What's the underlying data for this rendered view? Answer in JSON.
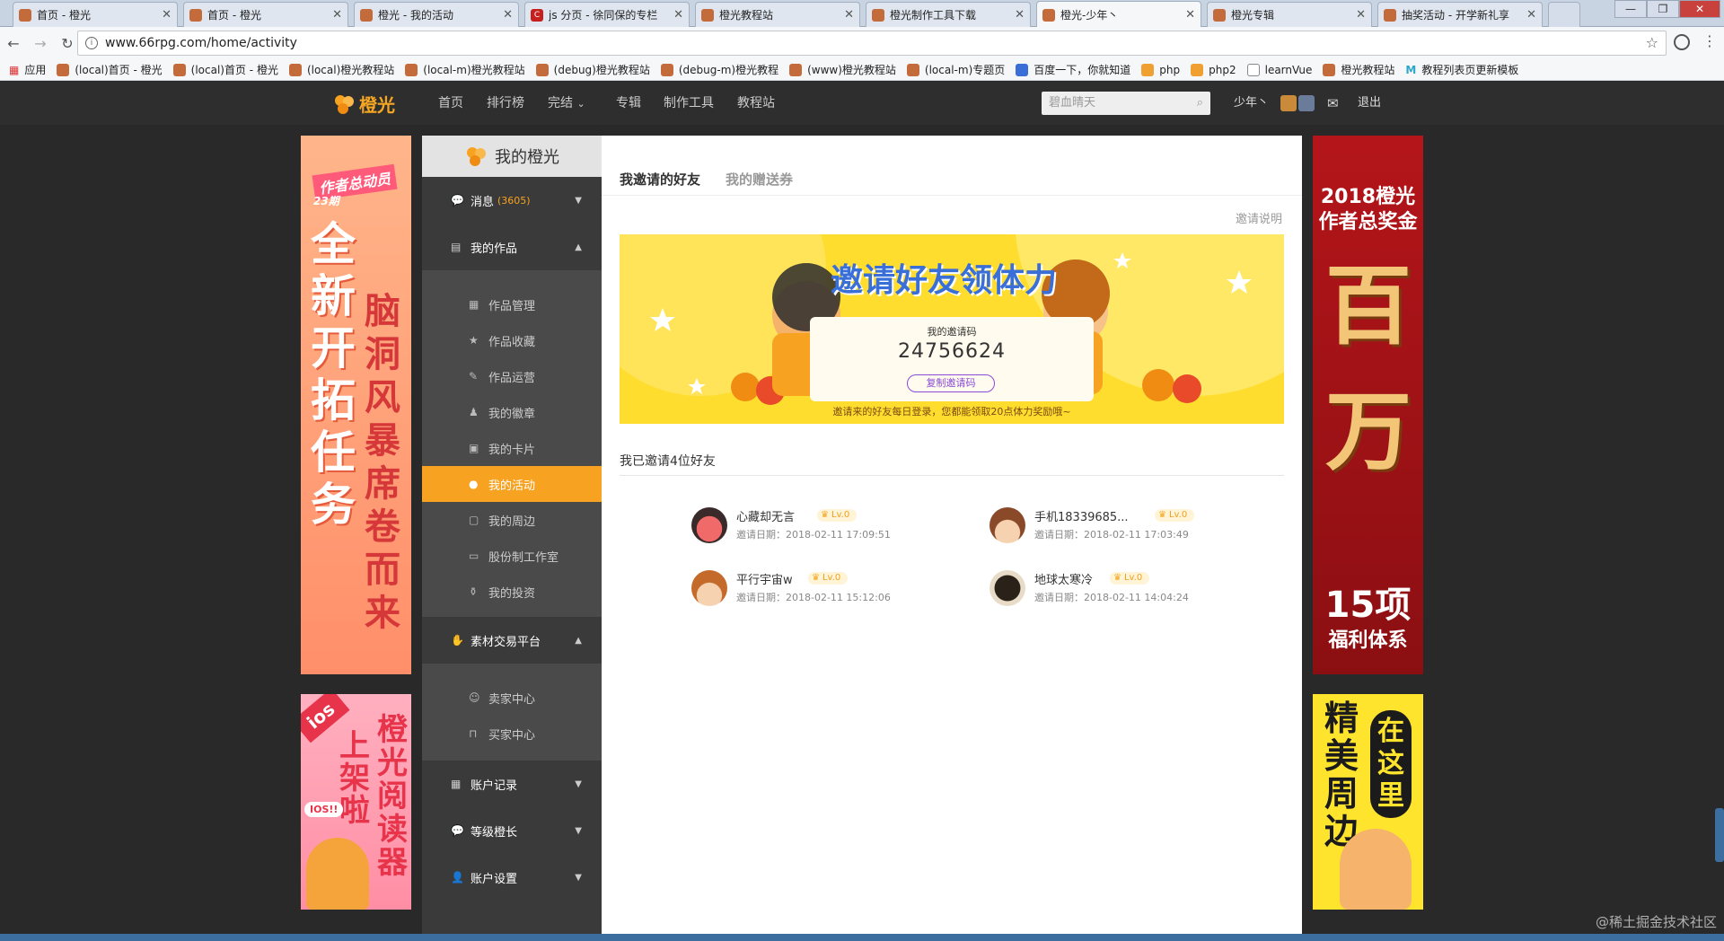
{
  "browser": {
    "tabs": [
      {
        "label": "首页 - 橙光",
        "active": false
      },
      {
        "label": "首页 - 橙光",
        "active": false
      },
      {
        "label": "橙光 - 我的活动",
        "active": false
      },
      {
        "label": "js 分页 - 徐同保的专栏",
        "active": false
      },
      {
        "label": "橙光教程站",
        "active": false
      },
      {
        "label": "橙光制作工具下载",
        "active": false
      },
      {
        "label": "橙光-少年丶",
        "active": true
      },
      {
        "label": "橙光专辑",
        "active": false
      },
      {
        "label": "抽奖活动 - 开学新礼享",
        "active": false
      }
    ],
    "url": "www.66rpg.com/home/activity",
    "bookmarks": [
      "应用",
      "(local)首页 - 橙光",
      "(local)首页 - 橙光",
      "(local)橙光教程站",
      "(local-m)橙光教程站",
      "(debug)橙光教程站",
      "(debug-m)橙光教程",
      "(www)橙光教程站",
      "(local-m)专题页",
      "百度一下，你就知道",
      "php",
      "php2",
      "learnVue",
      "橙光教程站",
      "教程列表页更新模板"
    ]
  },
  "site": {
    "logo_text": "橙光",
    "nav": [
      "首页",
      "排行榜",
      "完结",
      "专辑",
      "制作工具",
      "教程站"
    ],
    "nav_dropdown_marker": "⌄",
    "search_placeholder": "碧血晴天",
    "user_name": "少年丶",
    "logout": "退出"
  },
  "ads": {
    "left_top_badge": "作者总动员",
    "left_top_badge_issue": "23期",
    "left_top_col1": "全新开拓任务",
    "left_top_col2": "脑洞风暴席卷而来",
    "left_bottom_badge": "ios",
    "left_bottom_col1": "上架啦",
    "left_bottom_col2": "橙光阅读器",
    "left_bottom_bubble": "IOS!!",
    "right_top_line1": "2018橙光",
    "right_top_line2": "作者总奖金",
    "right_top_big": "百万",
    "right_top_line3": "15项",
    "right_top_line4": "福利体系",
    "right_bottom_col1": "精美周边",
    "right_bottom_col2": "在这里"
  },
  "sidebar": {
    "title": "我的橙光",
    "groups": [
      {
        "label": "消息",
        "count": "(3605)",
        "arrow": "▼"
      },
      {
        "label": "我的作品",
        "arrow": "▲"
      }
    ],
    "items": [
      "作品管理",
      "作品收藏",
      "作品运营",
      "我的徽章",
      "我的卡片",
      "我的活动",
      "我的周边",
      "股份制工作室",
      "我的投资"
    ],
    "market": {
      "label": "素材交易平台",
      "arrow": "▲"
    },
    "market_items": [
      "卖家中心",
      "买家中心"
    ],
    "bottom_groups": [
      {
        "label": "账户记录",
        "arrow": "▼"
      },
      {
        "label": "等级橙长",
        "arrow": "▼"
      },
      {
        "label": "账户设置",
        "arrow": "▼"
      }
    ]
  },
  "main": {
    "tab_invite": "我邀请的好友",
    "tab_coupon": "我的赠送券",
    "invite_help": "邀请说明",
    "promo_title": "邀请好友领体力",
    "code_label": "我的邀请码",
    "code_value": "24756624",
    "copy_button": "复制邀请码",
    "promo_footer": "邀请来的好友每日登录，您都能领取20点体力奖励哦~",
    "invited_title": "我已邀请4位好友",
    "friends": [
      {
        "name": "心藏却无言",
        "level": "Lv.0",
        "date": "邀请日期：2018-02-11 17:09:51"
      },
      {
        "name": "手机18339685...",
        "level": "Lv.0",
        "date": "邀请日期：2018-02-11 17:03:49"
      },
      {
        "name": "平行宇宙w",
        "level": "Lv.0",
        "date": "邀请日期：2018-02-11 15:12:06"
      },
      {
        "name": "地球太寒冷",
        "level": "Lv.0",
        "date": "邀请日期：2018-02-11 14:04:24"
      }
    ]
  },
  "watermark": "@稀土掘金技术社区",
  "colors": {
    "accent": "#f7a321",
    "sidebar": "#3a3a3a",
    "promo": "#ffdd2e"
  }
}
